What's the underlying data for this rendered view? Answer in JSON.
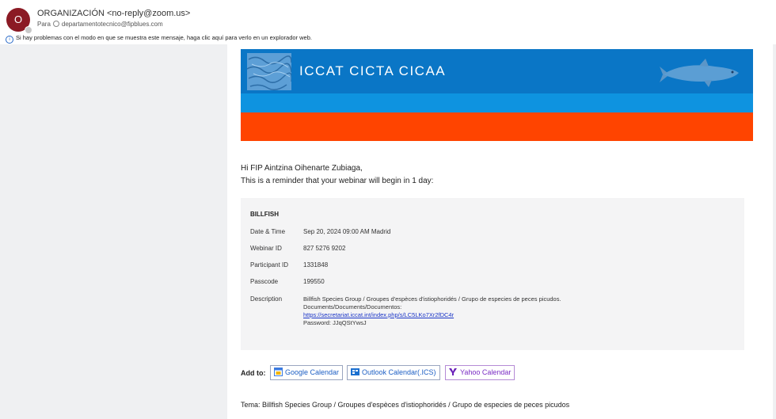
{
  "header": {
    "avatar_initial": "O",
    "sender": "ORGANIZACIÓN <no-reply@zoom.us>",
    "to_label": "Para",
    "to_address": "departamentotecnico@fipblues.com",
    "info_message": "Si hay problemas con el modo en que se muestra este mensaje, haga clic aquí para verlo en un explorador web."
  },
  "banner": {
    "title": "ICCAT  CICTA  CICAA"
  },
  "body": {
    "greeting": "Hi FIP Aintzina Oihenarte Zubiaga,",
    "reminder": "This is a reminder that your webinar will begin in 1 day:"
  },
  "card": {
    "title": "BILLFISH",
    "rows": [
      {
        "label": "Date & Time",
        "value": "Sep 20, 2024 09:00 AM Madrid"
      },
      {
        "label": "Webinar ID",
        "value": "827 5276 9202"
      },
      {
        "label": "Participant ID",
        "value": "1331848"
      },
      {
        "label": "Passcode",
        "value": "199550"
      }
    ],
    "description_label": "Description",
    "description_line1": "Billfish Species Group / Groupes d'espèces d'istiophoridés / Grupo de especies de peces picudos.",
    "description_line2": "Documents/Documents/Documentos:",
    "description_link": "https://secretariat.iccat.int/index.php/s/LC5LKo7Xr2fDC4r",
    "description_line4": "Password: JJqQStYwsJ"
  },
  "add_to": {
    "label": "Add to:",
    "google": "Google Calendar",
    "outlook": "Outlook Calendar(.ICS)",
    "yahoo": "Yahoo Calendar"
  },
  "tema": "Tema: Billfish Species Group / Groupes d'espèces d'istiophoridés / Grupo de especies de peces picudos",
  "colors": {
    "banner_blue": "#0a76c6",
    "banner_orange": "#ff4400",
    "avatar": "#8b1a24",
    "link": "#1a35c7"
  }
}
